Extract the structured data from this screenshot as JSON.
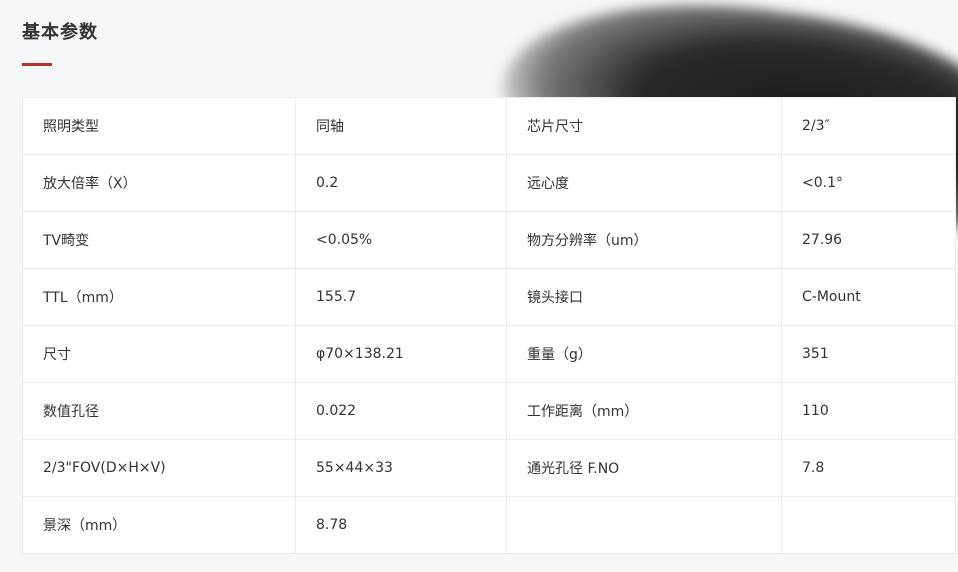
{
  "section": {
    "title": "基本参数"
  },
  "specs": {
    "rows": [
      [
        "照明类型",
        "同轴",
        "芯片尺寸",
        "2/3″"
      ],
      [
        "放大倍率（X）",
        "0.2",
        "远心度",
        "<0.1°"
      ],
      [
        "TV畸变",
        "<0.05%",
        "物方分辨率（um）",
        "27.96"
      ],
      [
        "TTL（mm）",
        "155.7",
        "镜头接口",
        "C-Mount"
      ],
      [
        "尺寸",
        "φ70×138.21",
        "重量（g）",
        "351"
      ],
      [
        "数值孔径",
        "0.022",
        "工作距离（mm）",
        "110"
      ],
      [
        "2/3\"FOV(D×H×V)",
        "55×44×33",
        "通光孔径 F.NO",
        "7.8"
      ],
      [
        "景深（mm）",
        "8.78",
        "",
        ""
      ]
    ]
  },
  "colors": {
    "accent": "#b1342b",
    "background": "#f6f7f9",
    "table_bg": "#ffffff",
    "border": "#ececec",
    "text": "#333333"
  }
}
